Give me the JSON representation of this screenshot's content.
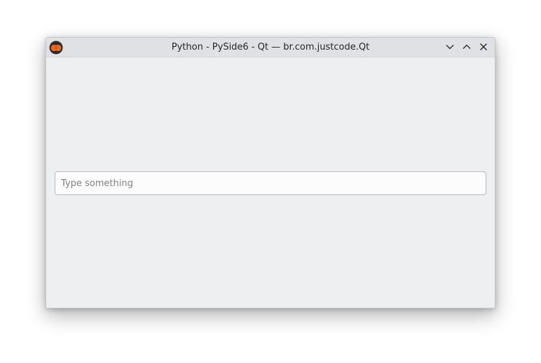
{
  "window": {
    "title": "Python - PySide6 - Qt — br.com.justcode.Qt",
    "app_icon": "pyside-app-icon",
    "controls": {
      "minimize_icon": "chevron-down-icon",
      "maximize_icon": "chevron-up-icon",
      "close_icon": "close-icon"
    }
  },
  "main": {
    "input": {
      "value": "",
      "placeholder": "Type something"
    }
  },
  "colors": {
    "window_background": "#eeeff1",
    "titlebar_background": "#dfe1e4",
    "icon_orange": "#f06a16",
    "icon_dark": "#2b2b2b"
  }
}
